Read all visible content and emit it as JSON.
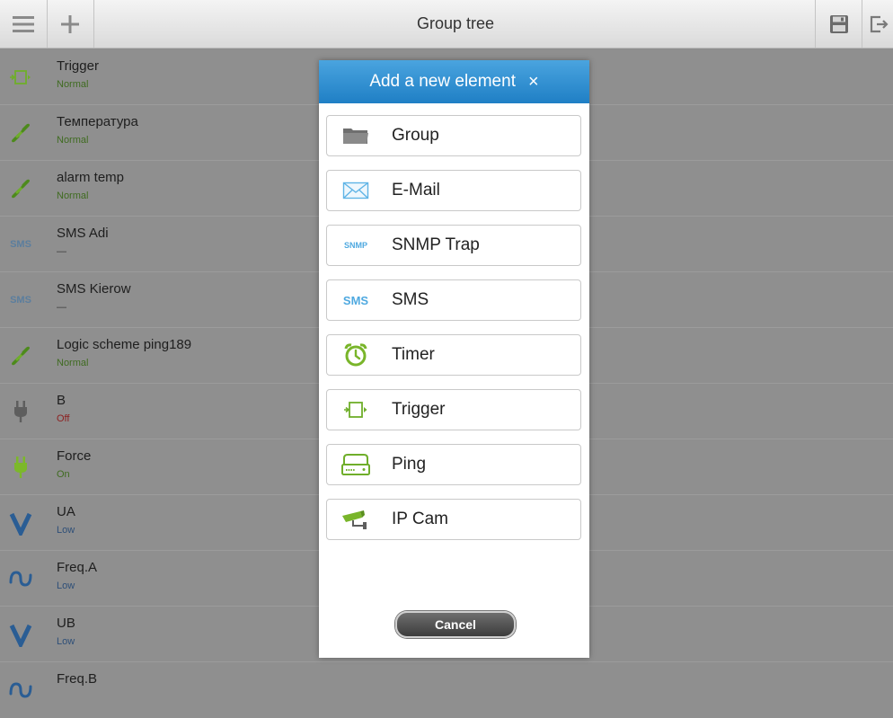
{
  "header": {
    "title": "Group tree",
    "menu_icon": "hamburger-menu-icon",
    "add_icon": "plus-icon",
    "save_icon": "floppy-save-icon",
    "exit_icon": "logout-icon"
  },
  "list": [
    {
      "name": "Trigger",
      "status": "Normal",
      "icon": "trigger-icon"
    },
    {
      "name": "Температура",
      "status": "Normal",
      "icon": "link-icon"
    },
    {
      "name": "alarm temp",
      "status": "Normal",
      "icon": "link-icon"
    },
    {
      "name": "SMS Adi",
      "status": "—",
      "icon": "sms-icon"
    },
    {
      "name": "SMS Kierow",
      "status": "—",
      "icon": "sms-icon"
    },
    {
      "name": "Logic scheme ping189",
      "status": "Normal",
      "icon": "link-icon"
    },
    {
      "name": "B",
      "status": "Off",
      "icon": "plug-icon"
    },
    {
      "name": "Force",
      "status": "On",
      "icon": "plug-icon"
    },
    {
      "name": "UA",
      "status": "Low",
      "icon": "voltage-icon"
    },
    {
      "name": "Freq.A",
      "status": "Low",
      "icon": "frequency-icon"
    },
    {
      "name": "UB",
      "status": "Low",
      "icon": "voltage-icon"
    },
    {
      "name": "Freq.B",
      "status": "",
      "icon": "frequency-icon"
    }
  ],
  "dialog": {
    "title": "Add a new element",
    "close": "×",
    "options": [
      {
        "label": "Group",
        "icon": "folder-icon"
      },
      {
        "label": "E-Mail",
        "icon": "envelope-icon"
      },
      {
        "label": "SNMP Trap",
        "icon": "snmp-icon",
        "icon_text": "SNMP"
      },
      {
        "label": "SMS",
        "icon": "sms-icon",
        "icon_text": "SMS"
      },
      {
        "label": "Timer",
        "icon": "alarm-clock-icon"
      },
      {
        "label": "Trigger",
        "icon": "trigger-icon"
      },
      {
        "label": "Ping",
        "icon": "ping-device-icon"
      },
      {
        "label": "IP Cam",
        "icon": "camera-icon"
      }
    ],
    "cancel_label": "Cancel"
  },
  "colors": {
    "accent_blue": "#2b8fd6",
    "status_green": "#3f6b20",
    "status_red": "#8c1f1f",
    "icon_green": "#6fae2a"
  }
}
